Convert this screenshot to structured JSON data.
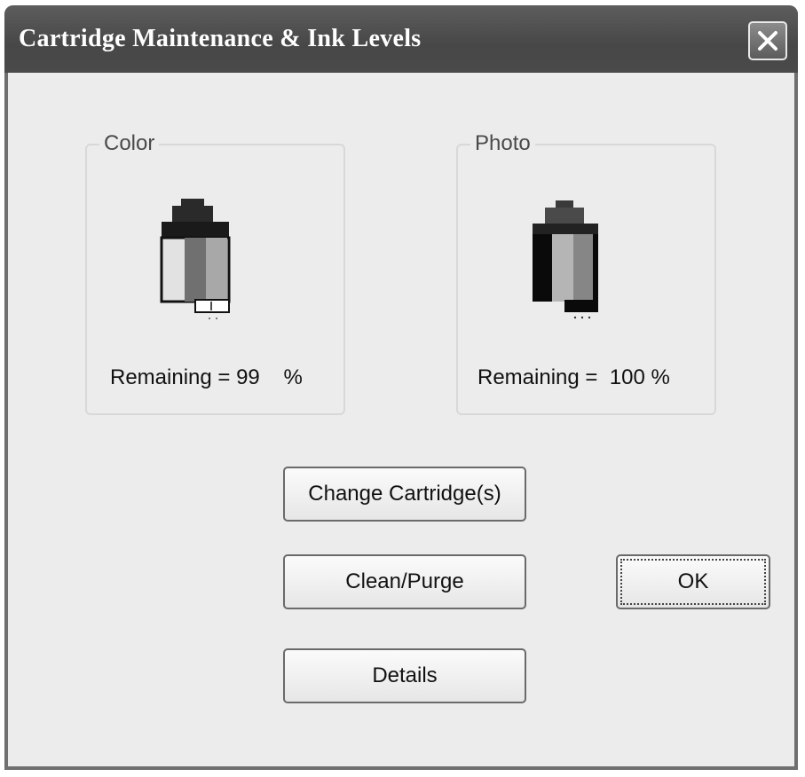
{
  "window": {
    "title": "Cartridge Maintenance & Ink Levels",
    "close_icon": "close-icon"
  },
  "cartridges": [
    {
      "group_label": "Color",
      "remaining_text": "Remaining = 99    %",
      "percent": 99,
      "icon": "color-cartridge-icon"
    },
    {
      "group_label": "Photo",
      "remaining_text": "Remaining =  100 %",
      "percent": 100,
      "icon": "photo-cartridge-icon"
    }
  ],
  "buttons": {
    "change_cartridges": "Change Cartridge(s)",
    "clean_purge": "Clean/Purge",
    "details": "Details",
    "ok": "OK"
  }
}
